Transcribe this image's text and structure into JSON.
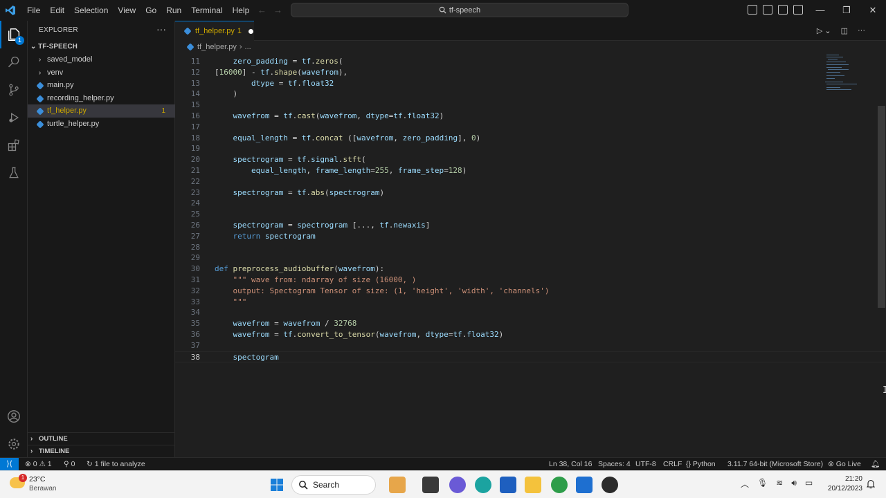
{
  "titlebar": {
    "menu": [
      "File",
      "Edit",
      "Selection",
      "View",
      "Go",
      "Run",
      "Terminal",
      "Help"
    ],
    "search_text": "tf-speech",
    "window_controls": [
      "—",
      "❐",
      "✕"
    ]
  },
  "sidebar": {
    "title": "EXPLORER",
    "more": "···",
    "folder": "TF-SPEECH",
    "items": [
      {
        "label": "saved_model",
        "type": "folder"
      },
      {
        "label": "venv",
        "type": "folder"
      },
      {
        "label": "main.py",
        "type": "file"
      },
      {
        "label": "recording_helper.py",
        "type": "file"
      },
      {
        "label": "tf_helper.py",
        "type": "file",
        "count": "1"
      },
      {
        "label": "turtle_helper.py",
        "type": "file"
      }
    ],
    "outline": "OUTLINE",
    "timeline": "TIMELINE",
    "explorer_badge": "1"
  },
  "editor": {
    "tab": {
      "label": "tf_helper.py",
      "count": "1"
    },
    "breadcrumb": {
      "file": "tf_helper.py",
      "sep": "›",
      "more": "..."
    },
    "lines": [
      {
        "n": "11",
        "text": "    zero_padding = tf.zeros("
      },
      {
        "n": "12",
        "text": "[16000] - tf.shape(wavefrom),"
      },
      {
        "n": "13",
        "text": "        dtype = tf.float32"
      },
      {
        "n": "14",
        "text": "    )"
      },
      {
        "n": "15",
        "text": ""
      },
      {
        "n": "16",
        "text": "    wavefrom = tf.cast(wavefrom, dtype=tf.float32)"
      },
      {
        "n": "17",
        "text": ""
      },
      {
        "n": "18",
        "text": "    equal_length = tf.concat ([wavefrom, zero_padding], 0)"
      },
      {
        "n": "19",
        "text": ""
      },
      {
        "n": "20",
        "text": "    spectrogram = tf.signal.stft("
      },
      {
        "n": "21",
        "text": "        equal_length, frame_length=255, frame_step=128)"
      },
      {
        "n": "22",
        "text": ""
      },
      {
        "n": "23",
        "text": "    spectrogram = tf.abs(spectrogram)"
      },
      {
        "n": "24",
        "text": ""
      },
      {
        "n": "25",
        "text": ""
      },
      {
        "n": "26",
        "text": "    spectrogram = spectrogram [..., tf.newaxis]"
      },
      {
        "n": "27",
        "text": "    return spectrogram"
      },
      {
        "n": "28",
        "text": ""
      },
      {
        "n": "29",
        "text": ""
      },
      {
        "n": "30",
        "text": "def preprocess_audiobuffer(wavefrom):"
      },
      {
        "n": "31",
        "text": "    \"\"\" wave from: ndarray of size (16000, )"
      },
      {
        "n": "32",
        "text": "    output: Spectogram Tensor of size: (1, 'height', 'width', 'channels')"
      },
      {
        "n": "33",
        "text": "    \"\"\""
      },
      {
        "n": "34",
        "text": ""
      },
      {
        "n": "35",
        "text": "    wavefrom = wavefrom / 32768"
      },
      {
        "n": "36",
        "text": "    wavefrom = tf.convert_to_tensor(wavefrom, dtype=tf.float32)"
      },
      {
        "n": "37",
        "text": ""
      },
      {
        "n": "38",
        "text": "    spectogram"
      }
    ]
  },
  "statusbar": {
    "remote": "⟩⟨",
    "problems": "⊗ 0 ⚠ 1",
    "ports": "⚲ 0",
    "analyze": "↻ 1 file to analyze",
    "position": "Ln 38, Col 16",
    "spaces": "Spaces: 4",
    "encoding": "UTF-8",
    "eol": "CRLF",
    "language": "{} Python",
    "interpreter": "3.11.7 64-bit (Microsoft Store)",
    "golive": "⊚ Go Live"
  },
  "taskbar": {
    "weather_temp": "23°C",
    "weather_cond": "Berawan",
    "weather_badge": "1",
    "search": "Search",
    "time": "21:20",
    "date": "20/12/2023"
  },
  "colors": {
    "accent": "#0078d4",
    "keyword": "#569cd6",
    "function": "#dcdcaa",
    "variable": "#9cdcfe",
    "string": "#ce9178",
    "number": "#b5cea8",
    "warning": "#cca700"
  }
}
